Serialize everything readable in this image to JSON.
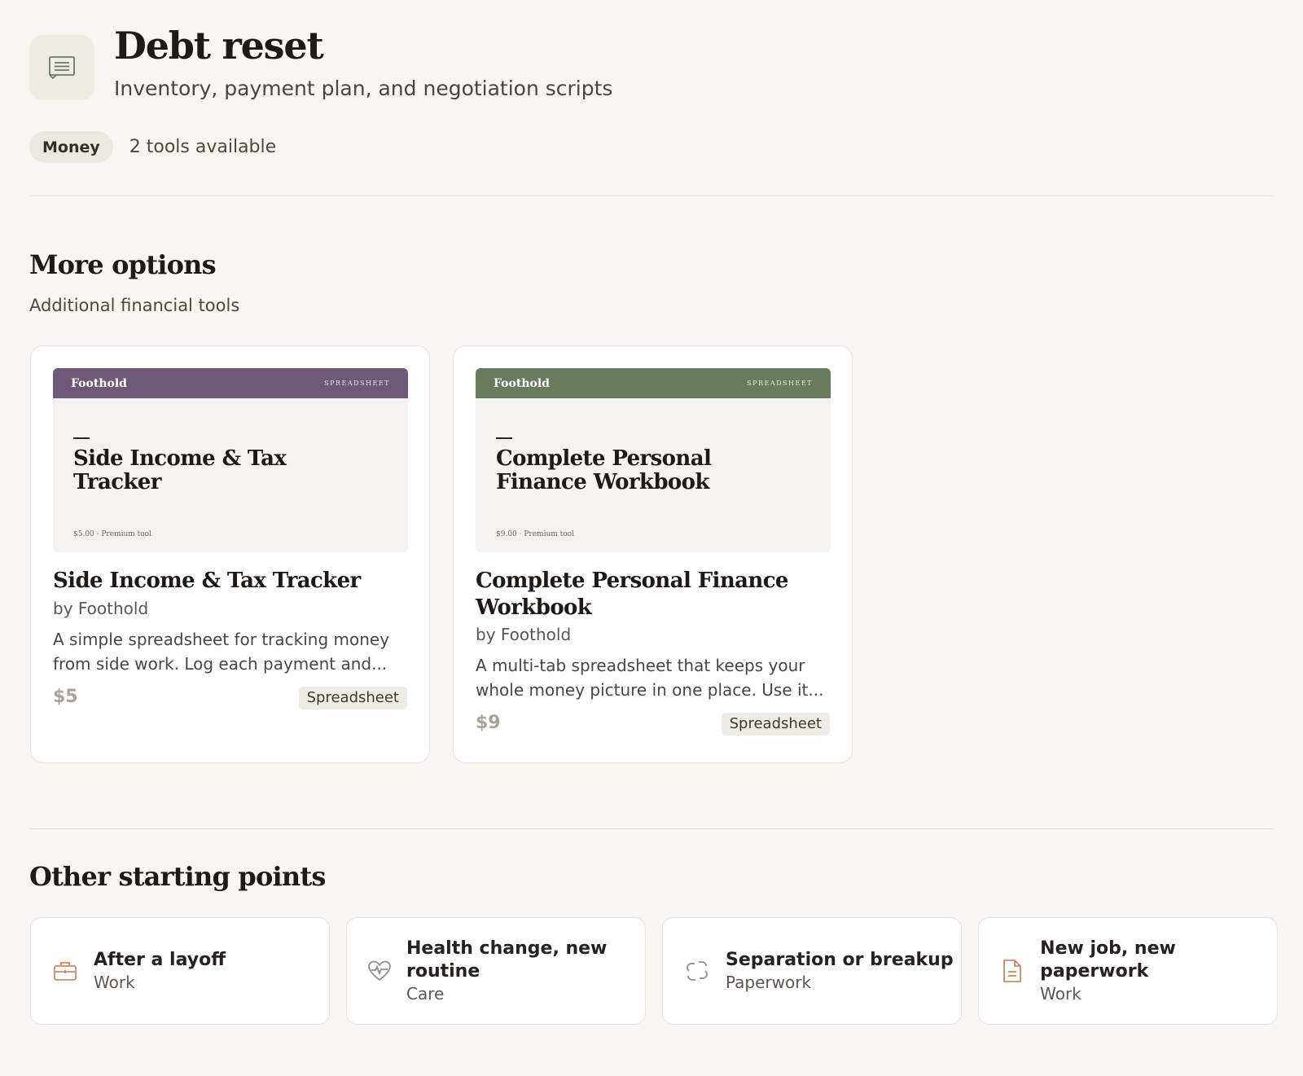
{
  "header": {
    "icon": "receipt-icon",
    "title": "Debt reset",
    "subtitle": "Inventory, payment plan, and negotiation scripts",
    "category_pill": "Money",
    "tools_count": "2 tools available"
  },
  "more_options": {
    "title": "More options",
    "subtitle": "Additional financial tools",
    "cards": [
      {
        "thumb_brand": "Foothold",
        "thumb_kind": "SPREADSHEET",
        "thumb_title": "Side Income & Tax Tracker",
        "thumb_price": "$5.00 · Premium tool",
        "thumb_color": "#6c5a78",
        "title": "Side Income & Tax Tracker",
        "by": "by Foothold",
        "description": "A simple spreadsheet for tracking money from side work. Log each payment and...",
        "price": "$5",
        "tag": "Spreadsheet"
      },
      {
        "thumb_brand": "Foothold",
        "thumb_kind": "SPREADSHEET",
        "thumb_title": "Complete Personal Finance Workbook",
        "thumb_price": "$9.00 · Premium tool",
        "thumb_color": "#6a7a5c",
        "title": "Complete Personal Finance Workbook",
        "by": "by Foothold",
        "description": "A multi-tab spreadsheet that keeps your whole money picture in one place. Use it...",
        "price": "$9",
        "tag": "Spreadsheet"
      }
    ]
  },
  "starting_points": {
    "title": "Other starting points",
    "items": [
      {
        "title": "After a layoff",
        "category": "Work",
        "icon": "briefcase-icon"
      },
      {
        "title": "Health change, new routine",
        "category": "Care",
        "icon": "heart-pulse-icon"
      },
      {
        "title": "Separation or breakup",
        "category": "Paperwork",
        "icon": "broken-link-icon"
      },
      {
        "title": "New job, new paperwork",
        "category": "Work",
        "icon": "document-icon"
      }
    ]
  },
  "colors": {
    "background": "#f8f6f3",
    "icon_accent": "#c98a6a"
  }
}
